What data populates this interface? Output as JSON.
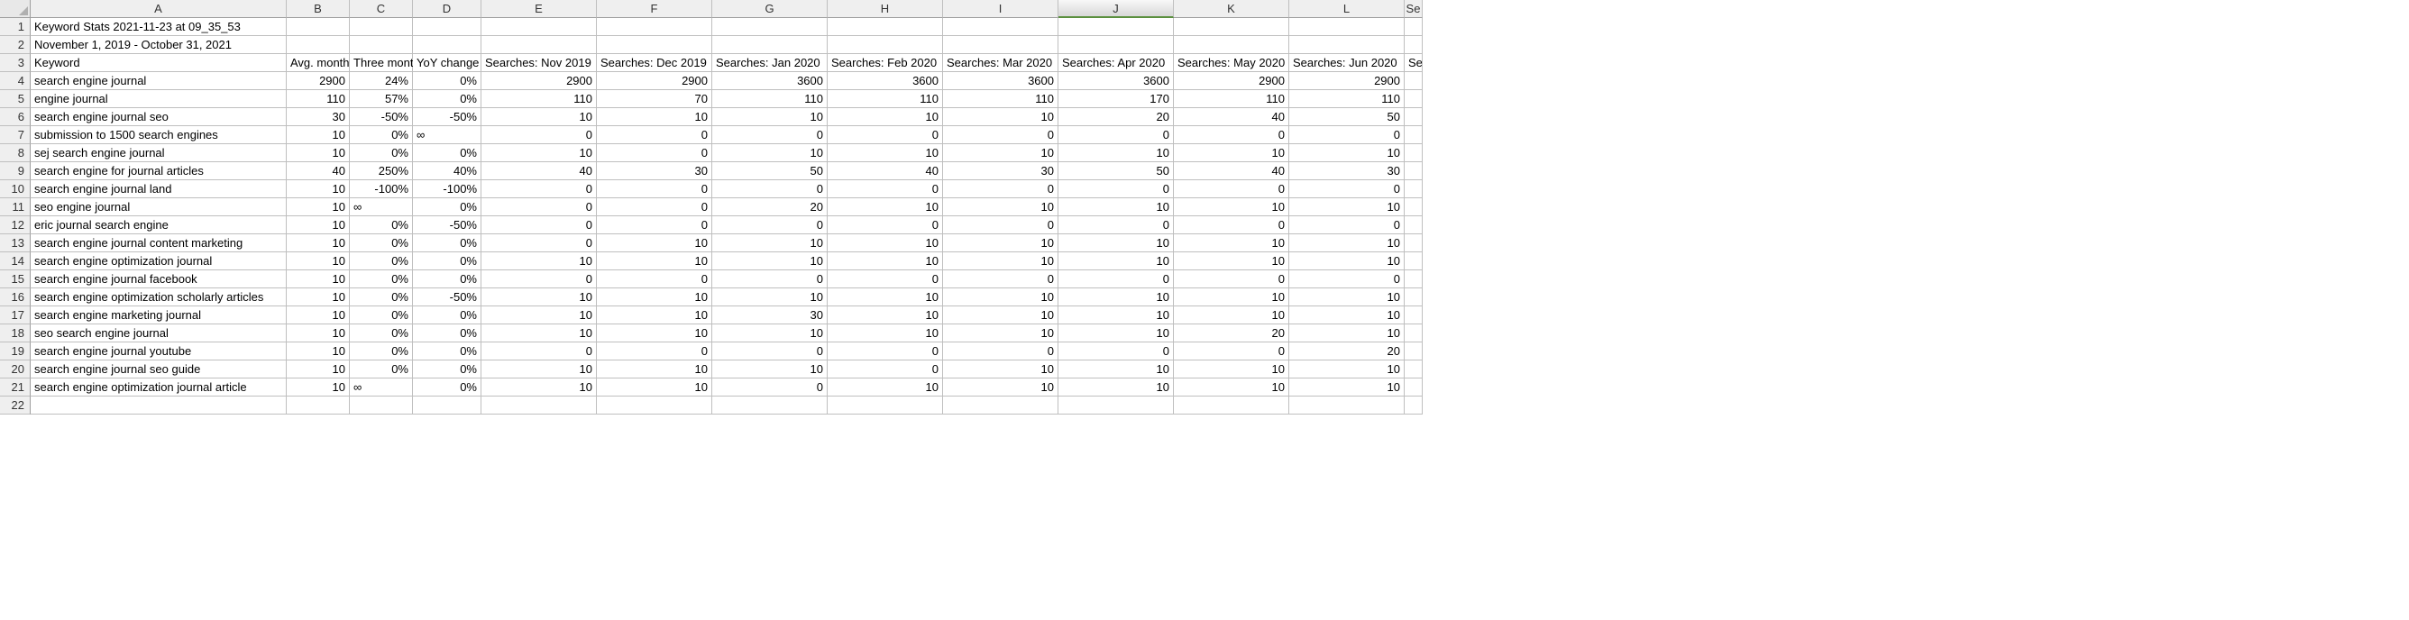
{
  "columns": [
    "A",
    "B",
    "C",
    "D",
    "E",
    "F",
    "G",
    "H",
    "I",
    "J",
    "K",
    "L"
  ],
  "active_column_index": 9,
  "row_count": 22,
  "partial_header": "Se",
  "meta_rows": [
    "Keyword Stats 2021-11-23 at 09_35_53",
    "November 1, 2019 - October 31, 2021"
  ],
  "header_row": {
    "A": "Keyword",
    "B": "Avg. monthly",
    "C": "Three month",
    "D": "YoY change",
    "E": "Searches: Nov 2019",
    "F": "Searches: Dec 2019",
    "G": "Searches: Jan 2020",
    "H": "Searches: Feb 2020",
    "I": "Searches: Mar 2020",
    "J": "Searches: Apr 2020",
    "K": "Searches: May 2020",
    "L": "Searches: Jun 2020"
  },
  "data_rows": [
    {
      "A": "search engine journal",
      "B": "2900",
      "C": "24%",
      "D": "0%",
      "E": "2900",
      "F": "2900",
      "G": "3600",
      "H": "3600",
      "I": "3600",
      "J": "3600",
      "K": "2900",
      "L": "2900"
    },
    {
      "A": "engine journal",
      "B": "110",
      "C": "57%",
      "D": "0%",
      "E": "110",
      "F": "70",
      "G": "110",
      "H": "110",
      "I": "110",
      "J": "170",
      "K": "110",
      "L": "110"
    },
    {
      "A": "search engine journal seo",
      "B": "30",
      "C": "-50%",
      "D": "-50%",
      "E": "10",
      "F": "10",
      "G": "10",
      "H": "10",
      "I": "10",
      "J": "20",
      "K": "40",
      "L": "50"
    },
    {
      "A": "submission to 1500 search engines",
      "B": "10",
      "C": "0%",
      "D": "∞",
      "E": "0",
      "F": "0",
      "G": "0",
      "H": "0",
      "I": "0",
      "J": "0",
      "K": "0",
      "L": "0"
    },
    {
      "A": "sej search engine journal",
      "B": "10",
      "C": "0%",
      "D": "0%",
      "E": "10",
      "F": "0",
      "G": "10",
      "H": "10",
      "I": "10",
      "J": "10",
      "K": "10",
      "L": "10"
    },
    {
      "A": "search engine for journal articles",
      "B": "40",
      "C": "250%",
      "D": "40%",
      "E": "40",
      "F": "30",
      "G": "50",
      "H": "40",
      "I": "30",
      "J": "50",
      "K": "40",
      "L": "30"
    },
    {
      "A": "search engine journal land",
      "B": "10",
      "C": "-100%",
      "D": "-100%",
      "E": "0",
      "F": "0",
      "G": "0",
      "H": "0",
      "I": "0",
      "J": "0",
      "K": "0",
      "L": "0"
    },
    {
      "A": "seo engine journal",
      "B": "10",
      "C": "∞",
      "D": "0%",
      "E": "0",
      "F": "0",
      "G": "20",
      "H": "10",
      "I": "10",
      "J": "10",
      "K": "10",
      "L": "10"
    },
    {
      "A": "eric journal search engine",
      "B": "10",
      "C": "0%",
      "D": "-50%",
      "E": "0",
      "F": "0",
      "G": "0",
      "H": "0",
      "I": "0",
      "J": "0",
      "K": "0",
      "L": "0"
    },
    {
      "A": "search engine journal content marketing",
      "B": "10",
      "C": "0%",
      "D": "0%",
      "E": "0",
      "F": "10",
      "G": "10",
      "H": "10",
      "I": "10",
      "J": "10",
      "K": "10",
      "L": "10"
    },
    {
      "A": "search engine optimization journal",
      "B": "10",
      "C": "0%",
      "D": "0%",
      "E": "10",
      "F": "10",
      "G": "10",
      "H": "10",
      "I": "10",
      "J": "10",
      "K": "10",
      "L": "10"
    },
    {
      "A": "search engine journal facebook",
      "B": "10",
      "C": "0%",
      "D": "0%",
      "E": "0",
      "F": "0",
      "G": "0",
      "H": "0",
      "I": "0",
      "J": "0",
      "K": "0",
      "L": "0"
    },
    {
      "A": "search engine optimization scholarly articles",
      "B": "10",
      "C": "0%",
      "D": "-50%",
      "E": "10",
      "F": "10",
      "G": "10",
      "H": "10",
      "I": "10",
      "J": "10",
      "K": "10",
      "L": "10"
    },
    {
      "A": "search engine marketing journal",
      "B": "10",
      "C": "0%",
      "D": "0%",
      "E": "10",
      "F": "10",
      "G": "30",
      "H": "10",
      "I": "10",
      "J": "10",
      "K": "10",
      "L": "10"
    },
    {
      "A": "seo search engine journal",
      "B": "10",
      "C": "0%",
      "D": "0%",
      "E": "10",
      "F": "10",
      "G": "10",
      "H": "10",
      "I": "10",
      "J": "10",
      "K": "20",
      "L": "10"
    },
    {
      "A": "search engine journal youtube",
      "B": "10",
      "C": "0%",
      "D": "0%",
      "E": "0",
      "F": "0",
      "G": "0",
      "H": "0",
      "I": "0",
      "J": "0",
      "K": "0",
      "L": "20"
    },
    {
      "A": "search engine journal seo guide",
      "B": "10",
      "C": "0%",
      "D": "0%",
      "E": "10",
      "F": "10",
      "G": "10",
      "H": "0",
      "I": "10",
      "J": "10",
      "K": "10",
      "L": "10"
    },
    {
      "A": "search engine optimization journal article",
      "B": "10",
      "C": "∞",
      "D": "0%",
      "E": "10",
      "F": "10",
      "G": "0",
      "H": "10",
      "I": "10",
      "J": "10",
      "K": "10",
      "L": "10"
    }
  ]
}
